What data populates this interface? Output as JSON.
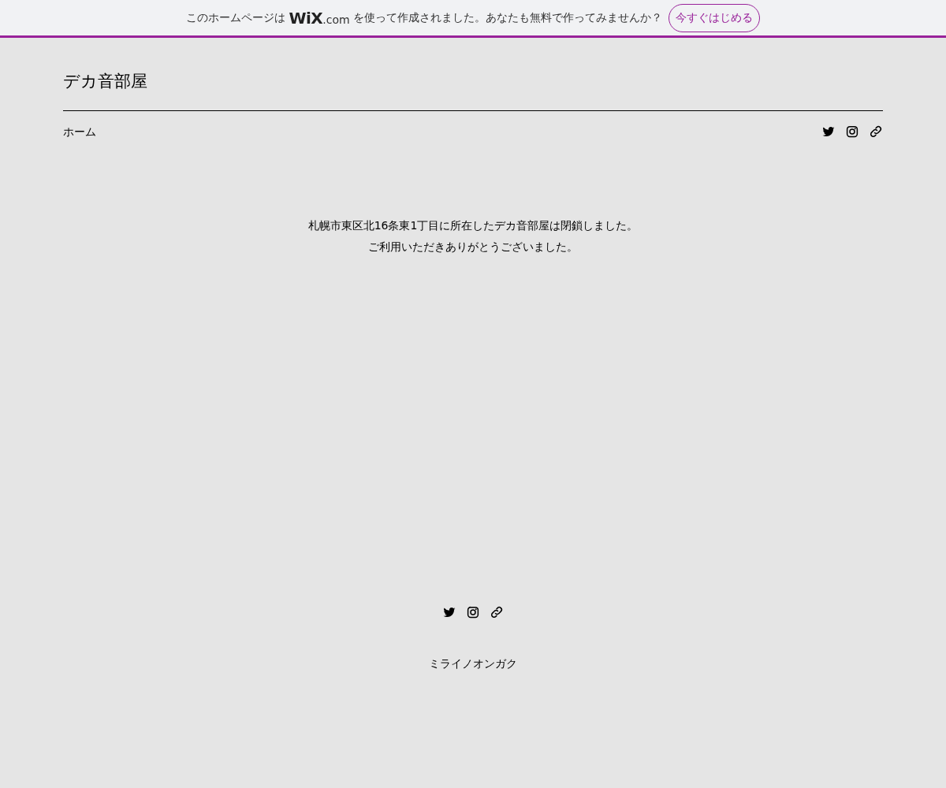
{
  "banner": {
    "text_before": "このホームページは",
    "logo": "WiX",
    "domain": ".com",
    "text_after": "を使って作成されました。あなたも無料で作ってみませんか？",
    "button": "今すぐはじめる"
  },
  "header": {
    "site_title": "デカ音部屋",
    "nav": [
      {
        "label": "ホーム",
        "selected": false
      }
    ],
    "social": [
      {
        "kind": "twitter"
      },
      {
        "kind": "instagram"
      },
      {
        "kind": "link"
      }
    ]
  },
  "main": {
    "lines": [
      "札幌市東区北16条東1丁目に所在したデカ音部屋は閉鎖しました。",
      "ご利用いただきありがとうございました。"
    ]
  },
  "footer": {
    "social": [
      {
        "kind": "twitter"
      },
      {
        "kind": "instagram"
      },
      {
        "kind": "link"
      }
    ],
    "text": "ミライノオンガク"
  }
}
